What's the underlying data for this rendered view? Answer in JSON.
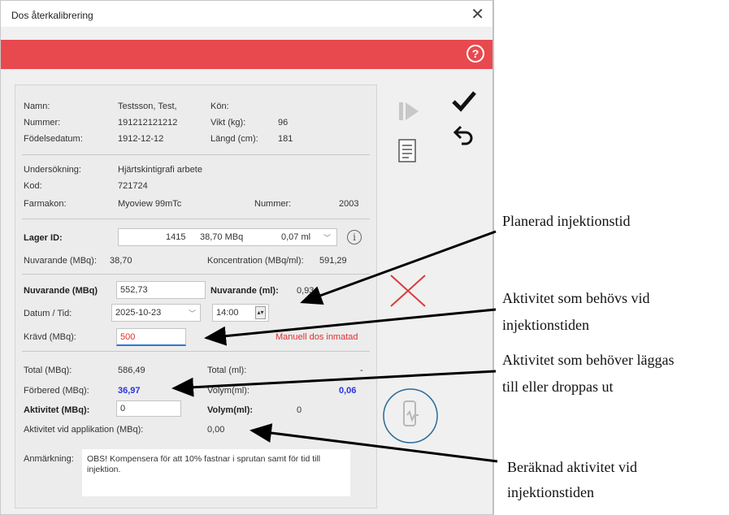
{
  "window": {
    "title": "Dos återkalibrering",
    "close_glyph": "✕",
    "help_glyph": "?"
  },
  "patient": {
    "name_label": "Namn:",
    "name": "Testsson, Test,",
    "gender_label": "Kön:",
    "gender": "",
    "number_label": "Nummer:",
    "number": "191212121212",
    "weight_label": "Vikt (kg):",
    "weight": "96",
    "birth_label": "Födelsedatum:",
    "birth": "1912-12-12",
    "height_label": "Längd (cm):",
    "height": "181"
  },
  "exam": {
    "exam_label": "Undersökning:",
    "exam": "Hjärtskintigrafi arbete",
    "code_label": "Kod:",
    "code": "721724",
    "drug_label": "Farmakon:",
    "drug": "Myoview 99mTc",
    "drug_number_label": "Nummer:",
    "drug_number": "2003"
  },
  "stock": {
    "label": "Lager ID:",
    "id": "1415",
    "activity": "38,70 MBq",
    "volume": "0,07 ml",
    "current_label": "Nuvarande (MBq):",
    "current": "38,70",
    "conc_label": "Koncentration (MBq/ml):",
    "conc": "591,29"
  },
  "calc": {
    "current_mbq_label": "Nuvarande (MBq)",
    "current_mbq": "552,73",
    "current_ml_label": "Nuvarande (ml):",
    "current_ml": "0,93",
    "date_label": "Datum / Tid:",
    "date": "2025-10-23",
    "time": "14:00",
    "required_label": "Krävd (MBq):",
    "required": "500",
    "manual_note": "Manuell dos inmatad"
  },
  "totals": {
    "total_mbq_label": "Total (MBq):",
    "total_mbq": "586,49",
    "total_ml_label": "Total (ml):",
    "total_ml": "-",
    "prepare_label": "Förbered (MBq):",
    "prepare": "36,97",
    "volume_label": "Volym(ml):",
    "volume_value": "0,06",
    "activity_label": "Aktivitet (MBq):",
    "activity": "0",
    "vol_ml_label": "Volym(ml):",
    "vol_ml": "0",
    "app_label": "Aktivitet vid applikation (MBq):",
    "app": "0,00"
  },
  "remark": {
    "label": "Anmärkning:",
    "text": "OBS! Kompensera för att 10% fastnar i sprutan samt för tid till injektion."
  },
  "icons": {
    "next": "next-step-icon",
    "report": "report-icon",
    "confirm": "checkmark-icon",
    "undo": "undo-icon",
    "cancel": "red-x-icon",
    "syringe": "syringe-circle-icon"
  },
  "annotations": {
    "a1": "Planerad injektionstid",
    "a2_l1": "Aktivitet som behövs vid",
    "a2_l2": "injektionstiden",
    "a3_l1": "Aktivitet som behöver läggas",
    "a3_l2": "till eller droppas ut",
    "a4_l1": "Beräknad aktivitet vid",
    "a4_l2": "injektionstiden"
  },
  "colors": {
    "accent_red": "#e8494e",
    "blue_value": "#2a34d8",
    "warning_red": "#e03030"
  }
}
